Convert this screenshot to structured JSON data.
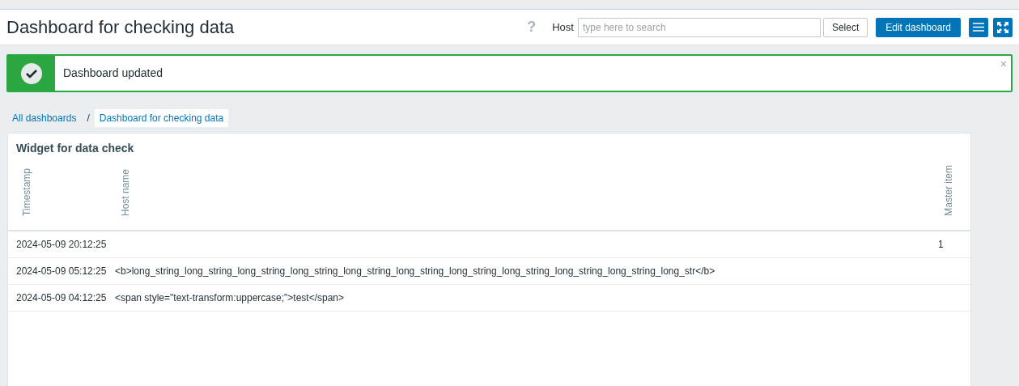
{
  "header": {
    "title": "Dashboard for checking data",
    "help": "?",
    "host_label": "Host",
    "host_search": {
      "placeholder": "type here to search"
    },
    "select_button": "Select",
    "edit_button": "Edit dashboard"
  },
  "message": {
    "text": "Dashboard updated",
    "close": "×"
  },
  "breadcrumbs": [
    {
      "label": "All dashboards",
      "selected": false
    },
    {
      "label": "Dashboard for checking data",
      "selected": true
    }
  ],
  "breadcrumb_separator": "/",
  "widget": {
    "title": "Widget for data check",
    "columns": [
      "Timestamp",
      "Host name",
      "Master item"
    ],
    "rows": [
      [
        "2024-05-09 20:12:25",
        "",
        "1"
      ],
      [
        "2024-05-09 05:12:25",
        "<b>long_string_long_string_long_string_long_string_long_string_long_string_long_string_long_string_long_string_long_string_long_str</b>",
        ""
      ],
      [
        "2024-05-09 04:12:25",
        "<span style=\"text-transform:uppercase;\">test</span>",
        ""
      ]
    ]
  }
}
